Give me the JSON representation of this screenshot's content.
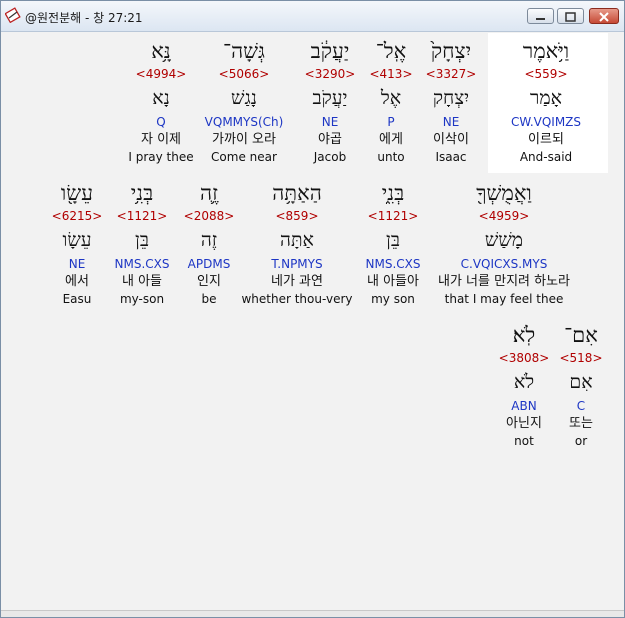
{
  "window": {
    "title": "@원전분해 - 창 27:21",
    "icon": "bible-app-icon",
    "controls": [
      "minimize",
      "maximize",
      "close"
    ]
  },
  "rows": [
    {
      "words": [
        {
          "heb": "וַיֹּ֥אמֶר",
          "strong": "<559>",
          "lex": "אָמַר",
          "parse": "CW.VQIMZS",
          "kor": "이르되",
          "eng": "And-said",
          "highlighted": true
        },
        {
          "heb": "יִצְחָק֙",
          "strong": "<3327>",
          "lex": "יִצְחָק",
          "parse": "NE",
          "kor": "이삭이",
          "eng": "Isaac"
        },
        {
          "heb": "אֶֽל־",
          "strong": "<413>",
          "lex": "אֶל",
          "parse": "P",
          "kor": "에게",
          "eng": "unto"
        },
        {
          "heb": "יַעֲקֹ֔ב",
          "strong": "<3290>",
          "lex": "יַעֲקֹב",
          "parse": "NE",
          "kor": "야곱",
          "eng": "Jacob"
        },
        {
          "heb": "גְּשָׁה־",
          "strong": "<5066>",
          "lex": "נָגַשׁ",
          "parse": "VQMMYS(Ch)",
          "kor": "가까이 오라",
          "eng": "Come near"
        },
        {
          "heb": "נָּ֥א",
          "strong": "<4994>",
          "lex": "נָא",
          "parse": "Q",
          "kor": "자 이제",
          "eng": "I pray thee"
        }
      ]
    },
    {
      "words": [
        {
          "heb": "וַאֲמֻשְׁךָ֖",
          "strong": "<4959>",
          "lex": "מָשַׁשׁ",
          "parse": "C.VQICXS.MYS",
          "kor": "내가 너를 만지려 하노라",
          "eng": "that I may feel thee"
        },
        {
          "heb": "בְּנִ֑י",
          "strong": "<1121>",
          "lex": "בֵּן",
          "parse": "NMS.CXS",
          "kor": "내 아들아",
          "eng": "my son"
        },
        {
          "heb": "הַאַתָּ֥ה",
          "strong": "<859>",
          "lex": "אַתָּה",
          "parse": "T.NPMYS",
          "kor": "네가 과연",
          "eng": "whether thou-very"
        },
        {
          "heb": "זֶ֛ה",
          "strong": "<2088>",
          "lex": "זֶה",
          "parse": "APDMS",
          "kor": "인지",
          "eng": "be"
        },
        {
          "heb": "בְּנִ֥י",
          "strong": "<1121>",
          "lex": "בֵּן",
          "parse": "NMS.CXS",
          "kor": "내 아들",
          "eng": "my-son"
        },
        {
          "heb": "עֵשָׂ֖ו",
          "strong": "<6215>",
          "lex": "עֵשָׂו",
          "parse": "NE",
          "kor": "에서",
          "eng": "Easu"
        }
      ]
    },
    {
      "words": [
        {
          "heb": "אִם־",
          "strong": "<518>",
          "lex": "אִם",
          "parse": "C",
          "kor": "또는",
          "eng": "or"
        },
        {
          "heb": "לֹֽא׃",
          "strong": "<3808>",
          "lex": "לֹא",
          "parse": "ABN",
          "kor": "아닌지",
          "eng": "not"
        }
      ]
    }
  ]
}
